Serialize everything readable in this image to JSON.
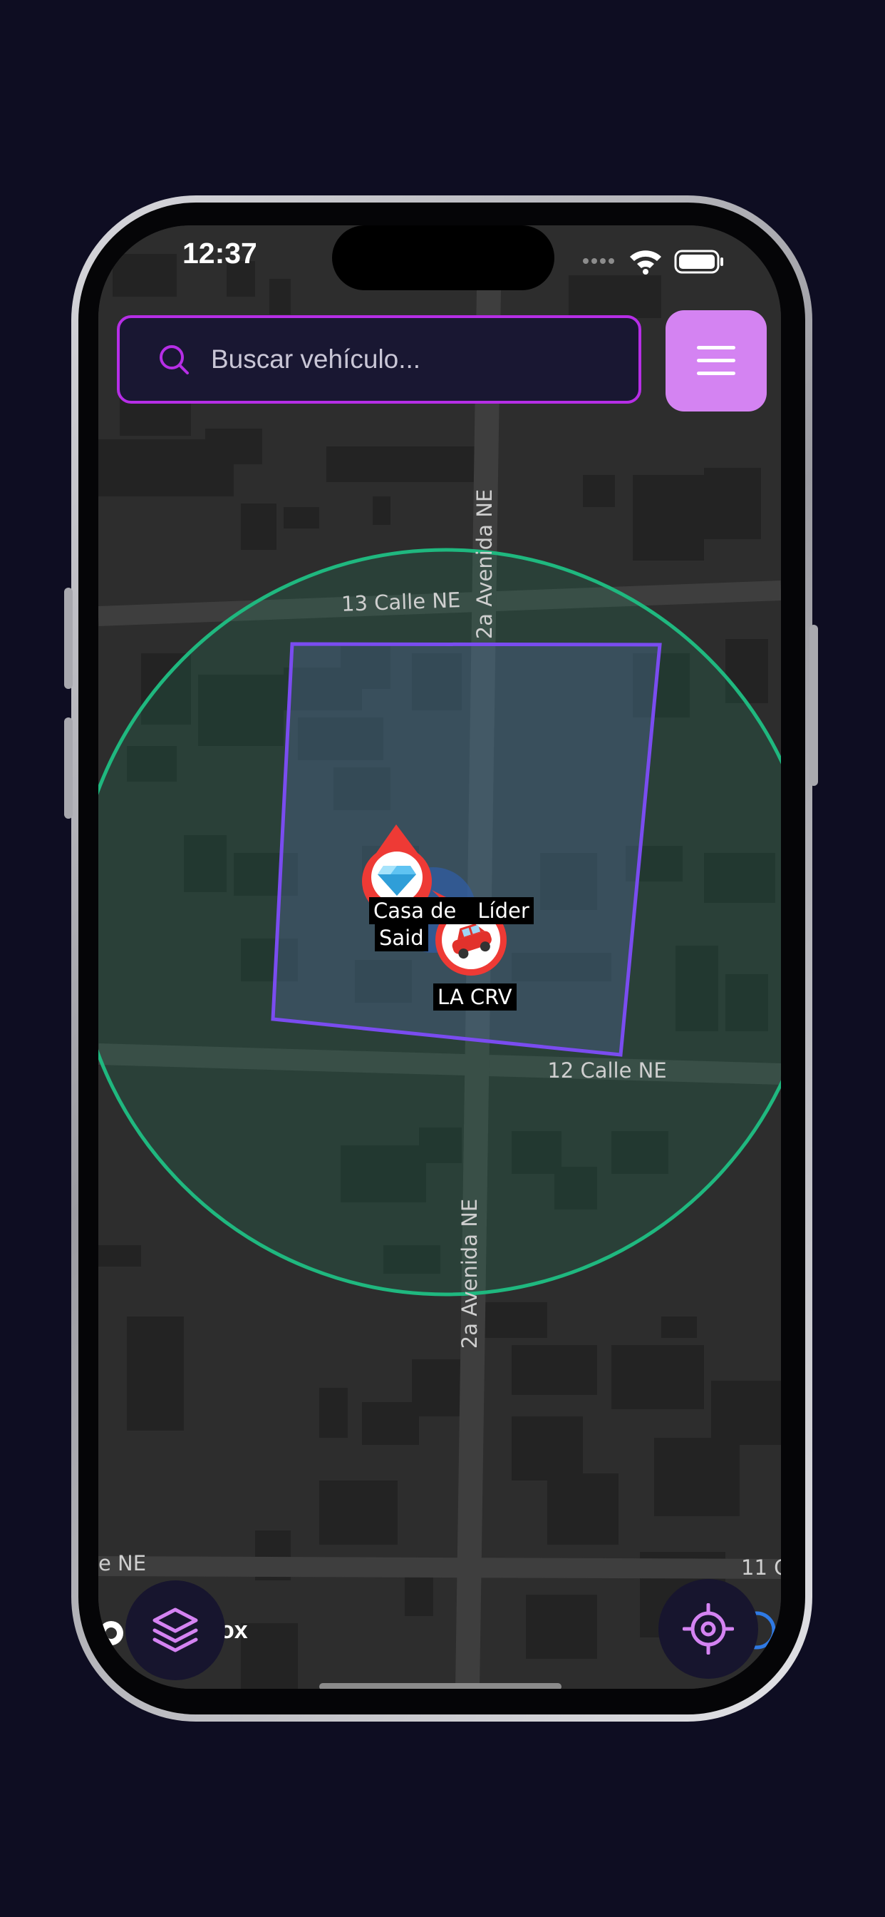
{
  "status_bar": {
    "time": "12:37"
  },
  "search": {
    "placeholder": "Buscar vehículo..."
  },
  "map": {
    "street_labels": {
      "calle_13": "13 Calle NE",
      "calle_12": "12 Calle NE",
      "avenida_top": "2a Avenida NE",
      "avenida_bottom": "2a Avenida NE",
      "calle_left_partial": "e NE",
      "calle_right_partial": "11 C"
    },
    "geofence_circle_color": "#1fb87f",
    "geofence_polygon_color": "#7a4cf0"
  },
  "markers": {
    "place": {
      "icon": "gem-icon",
      "label_line1": "Casa de",
      "label_line1_hidden_end": "Líder",
      "label_line2": "Said"
    },
    "vehicle": {
      "icon": "car-icon",
      "label": "LA CRV"
    }
  },
  "attribution": {
    "text": "ox"
  },
  "colors": {
    "accent": "#d483f2",
    "search_border": "#b62ee6",
    "marker_red": "#ee3a35"
  }
}
